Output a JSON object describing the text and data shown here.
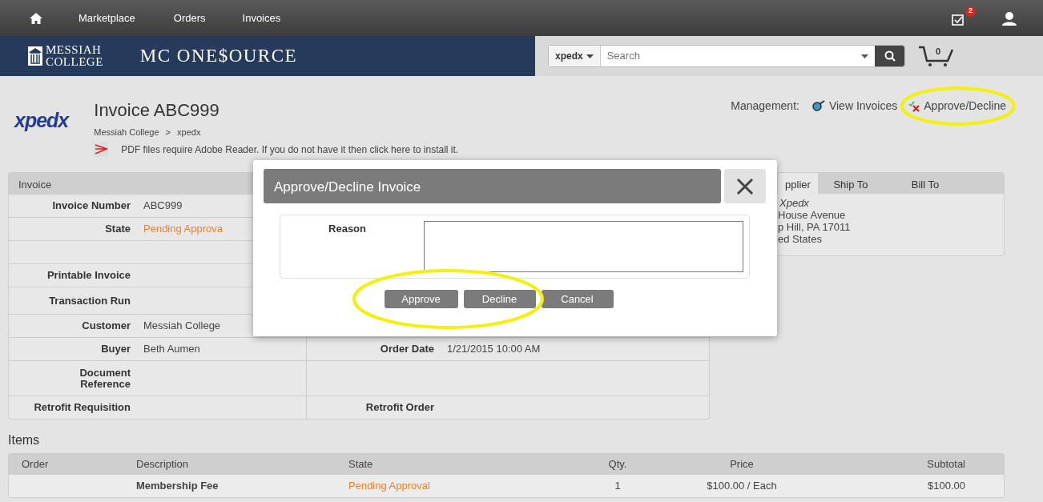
{
  "topnav": {
    "items": [
      {
        "label": "Marketplace"
      },
      {
        "label": "Orders"
      },
      {
        "label": "Invoices"
      }
    ],
    "notification_count": "2"
  },
  "brand": {
    "logo_lines": [
      "MESSIAH",
      "COLLEGE"
    ],
    "site_name": "MC ONE$OURCE"
  },
  "search": {
    "scope": "xpedx",
    "placeholder": "Search"
  },
  "cart_count": "0",
  "header": {
    "supplier_logo": "xpedx",
    "title": "Invoice ABC999",
    "breadcrumb": [
      "Messiah College",
      "xpedx"
    ],
    "breadcrumb_separator": ">",
    "pdf_notice": "PDF files require Adobe Reader. If you do not have it then click here to install it."
  },
  "management": {
    "label": "Management:",
    "links": [
      {
        "kind": "view",
        "label": "View Invoices"
      },
      {
        "kind": "approve",
        "label": "Approve/Decline"
      }
    ]
  },
  "invoice_panel": {
    "title": "Invoice",
    "rows": [
      {
        "label": "Invoice Number",
        "value": "ABC999"
      },
      {
        "label": "State",
        "value": "Pending Approva",
        "kind": "status"
      },
      {},
      {
        "label": "Printable Invoice"
      },
      {
        "label": "Transaction Run"
      },
      {
        "label": "Customer",
        "value": "Messiah College"
      },
      {
        "label": "Buyer",
        "value": "Beth Aumen",
        "right_label": "Order Date",
        "right_value": "1/21/2015 10:00 AM"
      },
      {
        "label": "Document Reference"
      },
      {
        "label": "Retrofit Requisition",
        "right_label": "Retrofit Order"
      }
    ]
  },
  "address_panel": {
    "tabs": [
      {
        "label": "pplier",
        "selected": true
      },
      {
        "label": "Ship To",
        "selected": false
      },
      {
        "label": "Bill To",
        "selected": false
      }
    ],
    "name": "Xpedx",
    "lines": [
      "House Avenue",
      "p Hill,  PA  17011",
      "ed States"
    ]
  },
  "modal": {
    "title": "Approve/Decline Invoice",
    "reason_label": "Reason",
    "buttons": [
      {
        "label": "Approve"
      },
      {
        "label": "Decline"
      },
      {
        "label": "Cancel"
      }
    ]
  },
  "items": {
    "title": "Items",
    "columns": [
      "Order",
      "Description",
      "State",
      "Qty.",
      "Price",
      "Subtotal"
    ],
    "rows": [
      {
        "description": "Membership Fee",
        "state": "Pending Approval",
        "qty": "1",
        "price": "$100.00 / Each",
        "subtotal": "$100.00"
      }
    ]
  }
}
